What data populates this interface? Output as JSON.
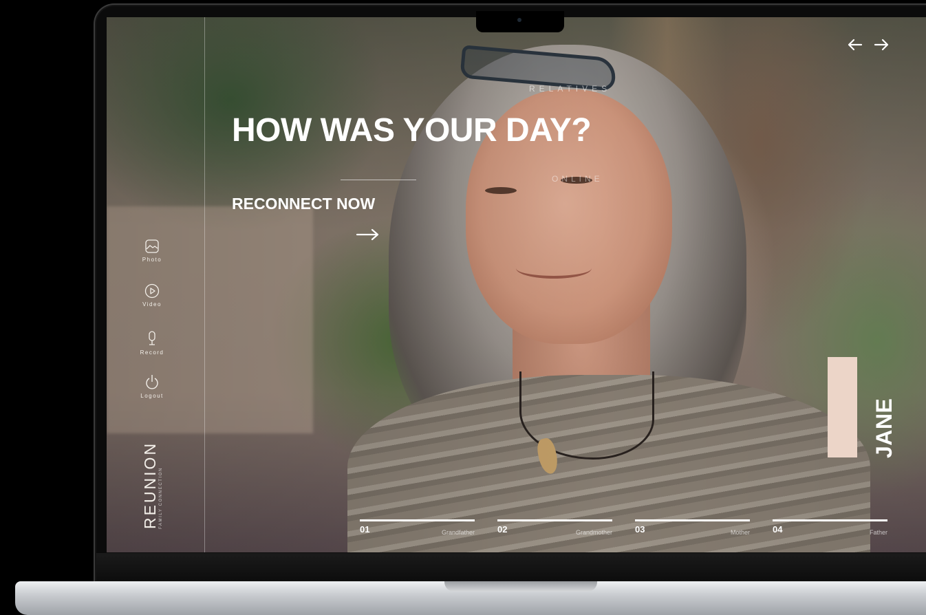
{
  "hero": {
    "section_label": "RELATIVES",
    "headline": "HOW WAS YOUR DAY?",
    "status_label": "ONLINE",
    "cta_label": "RECONNECT NOW"
  },
  "sidebar": {
    "items": [
      {
        "label": "Photo",
        "icon": "image-icon"
      },
      {
        "label": "Video",
        "icon": "play-circle-icon"
      },
      {
        "label": "Record",
        "icon": "microphone-icon"
      },
      {
        "label": "Logout",
        "icon": "power-icon"
      }
    ],
    "logo": "REUNION",
    "logo_tagline": "FAMILY CONNECTION"
  },
  "profile": {
    "name": "JANE",
    "accent_color": "#ECD5C8"
  },
  "relatives": [
    {
      "number": "01",
      "label": "Grandfather"
    },
    {
      "number": "02",
      "label": "Grandmother"
    },
    {
      "number": "03",
      "label": "Mother"
    },
    {
      "number": "04",
      "label": "Father"
    }
  ],
  "navigation": {
    "prev_icon": "arrow-left-icon",
    "next_icon": "arrow-right-icon"
  }
}
